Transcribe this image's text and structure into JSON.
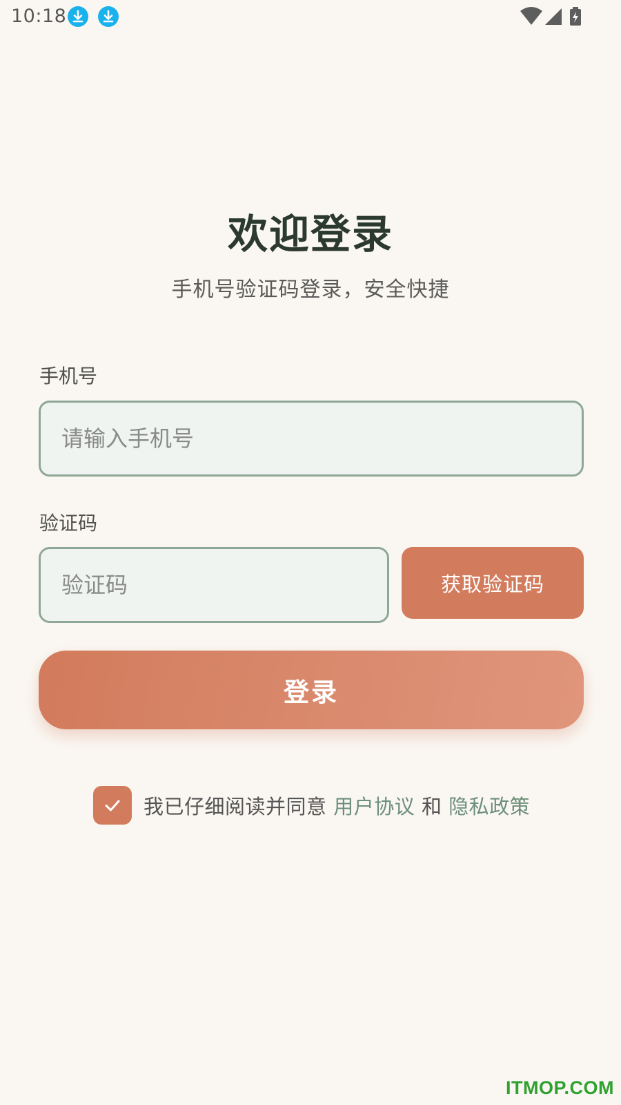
{
  "status_bar": {
    "time": "10:18",
    "icons": [
      "download-icon",
      "download-icon",
      "wifi-icon",
      "signal-icon",
      "battery-charging-icon"
    ],
    "accent": "#1ab2ec"
  },
  "header": {
    "title": "欢迎登录",
    "subtitle": "手机号验证码登录，安全快捷"
  },
  "form": {
    "phone_label": "手机号",
    "phone_placeholder": "请输入手机号",
    "phone_value": "",
    "code_label": "验证码",
    "code_placeholder": "验证码",
    "code_value": "",
    "get_code_label": "获取验证码",
    "login_label": "登录"
  },
  "agreement": {
    "checked": true,
    "prefix": "我已仔细阅读并同意 ",
    "link1": "用户协议",
    "middle": " 和 ",
    "link2": "隐私政策"
  },
  "watermark": "ITMOP.COM",
  "colors": {
    "background": "#faf7f2",
    "primary": "#d27c5d",
    "input_bg": "#eff4f0",
    "input_border": "#8fa796",
    "link": "#6d8f79",
    "title": "#2b3a2d"
  }
}
